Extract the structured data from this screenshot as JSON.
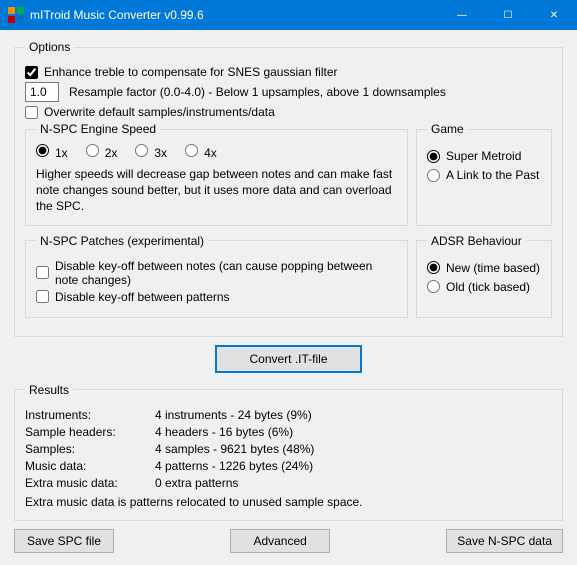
{
  "window": {
    "title": "mITroid Music Converter v0.99.6",
    "buttons": {
      "min": "—",
      "max": "☐",
      "close": "✕"
    }
  },
  "options": {
    "legend": "Options",
    "enhance_treble_label": "Enhance treble to compensate for SNES gaussian filter",
    "enhance_treble_checked": true,
    "resample_value": "1.0",
    "resample_label": "Resample factor (0.0-4.0) - Below 1 upsamples, above 1 downsamples",
    "overwrite_label": "Overwrite default samples/instruments/data",
    "overwrite_checked": false
  },
  "engine_speed": {
    "legend": "N-SPC Engine Speed",
    "options": [
      "1x",
      "2x",
      "3x",
      "4x"
    ],
    "selected": "1x",
    "hint": "Higher speeds will decrease gap between notes and can make fast note changes sound better, but it uses more data and can overload the SPC."
  },
  "game": {
    "legend": "Game",
    "options": [
      "Super Metroid",
      "A Link to the Past"
    ],
    "selected": "Super Metroid"
  },
  "patches": {
    "legend": "N-SPC Patches (experimental)",
    "disable_keyoff_notes_label": "Disable key-off between notes (can cause popping between note changes)",
    "disable_keyoff_notes_checked": false,
    "disable_keyoff_patterns_label": "Disable key-off between patterns",
    "disable_keyoff_patterns_checked": false
  },
  "adsr": {
    "legend": "ADSR Behaviour",
    "options": [
      "New (time based)",
      "Old (tick based)"
    ],
    "selected": "New (time based)"
  },
  "convert_button": "Convert .IT-file",
  "results": {
    "legend": "Results",
    "rows": [
      {
        "k": "Instruments:",
        "v": "4 instruments - 24 bytes (9%)"
      },
      {
        "k": "Sample headers:",
        "v": "4 headers - 16 bytes (6%)"
      },
      {
        "k": "Samples:",
        "v": "4 samples - 9621 bytes (48%)"
      },
      {
        "k": "Music data:",
        "v": "4 patterns - 1226 bytes (24%)"
      },
      {
        "k": "Extra music data:",
        "v": "0 extra patterns"
      }
    ],
    "note": "Extra music data is patterns relocated to unused sample space."
  },
  "footer": {
    "save_spc": "Save SPC file",
    "advanced": "Advanced",
    "save_nspc": "Save N-SPC data"
  }
}
